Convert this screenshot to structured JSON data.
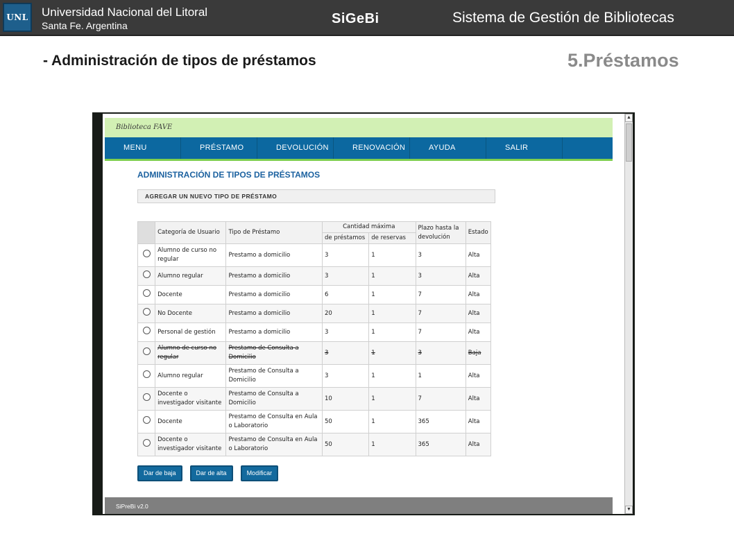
{
  "header": {
    "logo_text": "UNL",
    "university": "Universidad Nacional del Litoral",
    "city": "Santa Fe. Argentina",
    "brand": "SiGeBi",
    "system_name": "Sistema de Gestión de Bibliotecas"
  },
  "slide": {
    "title": "- Administración de tipos de préstamos",
    "section": "5.Préstamos"
  },
  "app": {
    "library_name": "Biblioteca FAVE",
    "nav": [
      "MENU",
      "PRÉSTAMO",
      "DEVOLUCIÓN",
      "RENOVACIÓN",
      "AYUDA",
      "SALIR"
    ],
    "page_heading": "ADMINISTRACIÓN DE TIPOS DE PRÉSTAMOS",
    "add_type_label": "AGREGAR UN NUEVO TIPO DE PRÉSTAMO",
    "table": {
      "headers": {
        "category": "Categoría de Usuario",
        "loan_type": "Tipo de Préstamo",
        "max_qty": "Cantidad máxima",
        "max_loans": "de préstamos",
        "max_reservations": "de reservas",
        "deadline": "Plazo hasta la devolución",
        "status": "Estado"
      },
      "rows": [
        {
          "category": "Alumno de curso no regular",
          "loan_type": "Prestamo a domicilio",
          "max_loans": "3",
          "max_reservations": "1",
          "deadline": "3",
          "status": "Alta",
          "struck": false
        },
        {
          "category": "Alumno regular",
          "loan_type": "Prestamo a domicilio",
          "max_loans": "3",
          "max_reservations": "1",
          "deadline": "3",
          "status": "Alta",
          "struck": false
        },
        {
          "category": "Docente",
          "loan_type": "Prestamo a domicilio",
          "max_loans": "6",
          "max_reservations": "1",
          "deadline": "7",
          "status": "Alta",
          "struck": false
        },
        {
          "category": "No Docente",
          "loan_type": "Prestamo a domicilio",
          "max_loans": "20",
          "max_reservations": "1",
          "deadline": "7",
          "status": "Alta",
          "struck": false
        },
        {
          "category": "Personal de gestión",
          "loan_type": "Prestamo a domicilio",
          "max_loans": "3",
          "max_reservations": "1",
          "deadline": "7",
          "status": "Alta",
          "struck": false
        },
        {
          "category": "Alumno de curso no regular",
          "loan_type": "Prestamo de Consulta a Domicilio",
          "max_loans": "3",
          "max_reservations": "1",
          "deadline": "3",
          "status": "Baja",
          "struck": true
        },
        {
          "category": "Alumno regular",
          "loan_type": "Prestamo de Consulta a Domicilio",
          "max_loans": "3",
          "max_reservations": "1",
          "deadline": "1",
          "status": "Alta",
          "struck": false
        },
        {
          "category": "Docente o investigador visitante",
          "loan_type": "Prestamo de Consulta a Domicilio",
          "max_loans": "10",
          "max_reservations": "1",
          "deadline": "7",
          "status": "Alta",
          "struck": false
        },
        {
          "category": "Docente",
          "loan_type": "Prestamo de Consulta en Aula o Laboratorio",
          "max_loans": "50",
          "max_reservations": "1",
          "deadline": "365",
          "status": "Alta",
          "struck": false
        },
        {
          "category": "Docente o investigador visitante",
          "loan_type": "Prestamo de Consulta en Aula o Laboratorio",
          "max_loans": "50",
          "max_reservations": "1",
          "deadline": "365",
          "status": "Alta",
          "struck": false
        }
      ]
    },
    "buttons": {
      "deactivate": "Dar de baja",
      "activate": "Dar de alta",
      "modify": "Modificar"
    },
    "footer": "SiPreBi v2.0"
  },
  "scrollbar": {
    "up_arrow": "▲",
    "down_arrow": "▼"
  }
}
